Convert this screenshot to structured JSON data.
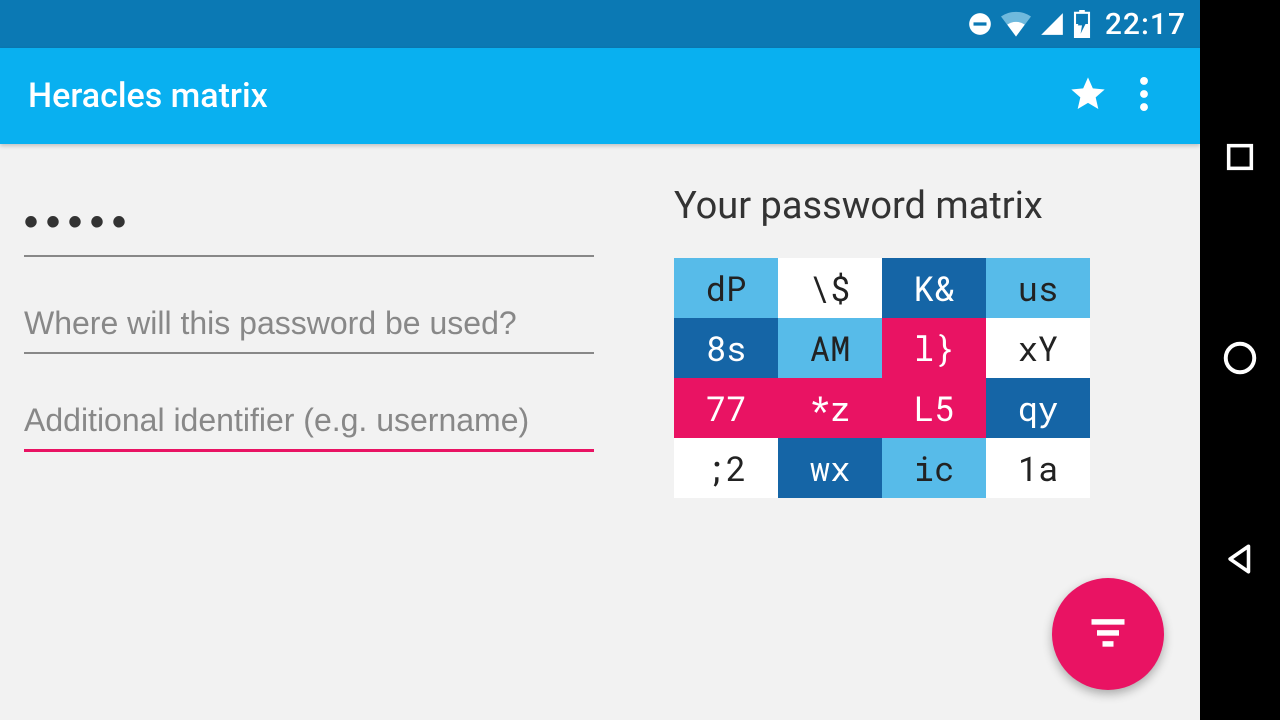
{
  "status": {
    "time": "22:17"
  },
  "appbar": {
    "title": "Heracles matrix"
  },
  "fields": {
    "master_value": "•••••",
    "where_placeholder": "Where will this password be used?",
    "ident_placeholder": "Additional identifier (e.g. username)"
  },
  "matrix": {
    "title": "Your password matrix",
    "cells": [
      {
        "t": "dP",
        "c": "lblue"
      },
      {
        "t": "\\$",
        "c": "white"
      },
      {
        "t": "K&",
        "c": "dblue"
      },
      {
        "t": "us",
        "c": "lblue"
      },
      {
        "t": "8s",
        "c": "dblue"
      },
      {
        "t": "AM",
        "c": "lblue"
      },
      {
        "t": "l}",
        "c": "pink"
      },
      {
        "t": "xY",
        "c": "white"
      },
      {
        "t": "77",
        "c": "pink"
      },
      {
        "t": "*z",
        "c": "pink"
      },
      {
        "t": "L5",
        "c": "pink"
      },
      {
        "t": "qy",
        "c": "dblue"
      },
      {
        "t": ";2",
        "c": "white"
      },
      {
        "t": "wx",
        "c": "dblue"
      },
      {
        "t": "ic",
        "c": "lblue"
      },
      {
        "t": "1a",
        "c": "white"
      }
    ]
  }
}
